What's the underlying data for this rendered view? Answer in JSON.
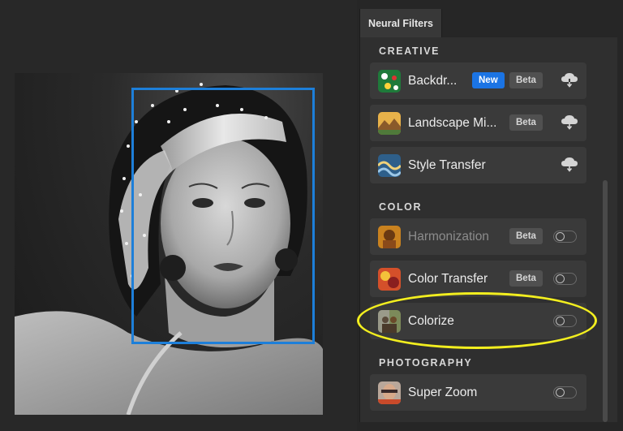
{
  "panel": {
    "tab_label": "Neural Filters",
    "sections": {
      "creative": "CREATIVE",
      "color": "COLOR",
      "photography": "PHOTOGRAPHY"
    },
    "filters": {
      "backdrop": {
        "name": "Backdr...",
        "badge_new": "New",
        "badge_beta": "Beta"
      },
      "landscape": {
        "name": "Landscape Mi...",
        "badge_beta": "Beta"
      },
      "style_transfer": {
        "name": "Style Transfer"
      },
      "harmonization": {
        "name": "Harmonization",
        "badge_beta": "Beta"
      },
      "color_transfer": {
        "name": "Color Transfer",
        "badge_beta": "Beta"
      },
      "colorize": {
        "name": "Colorize"
      },
      "super_zoom": {
        "name": "Super Zoom"
      }
    }
  },
  "colors": {
    "selection_frame": "#1d7fd9",
    "highlight_ellipse": "#f2ee1f",
    "new_badge": "#1b74e4"
  }
}
